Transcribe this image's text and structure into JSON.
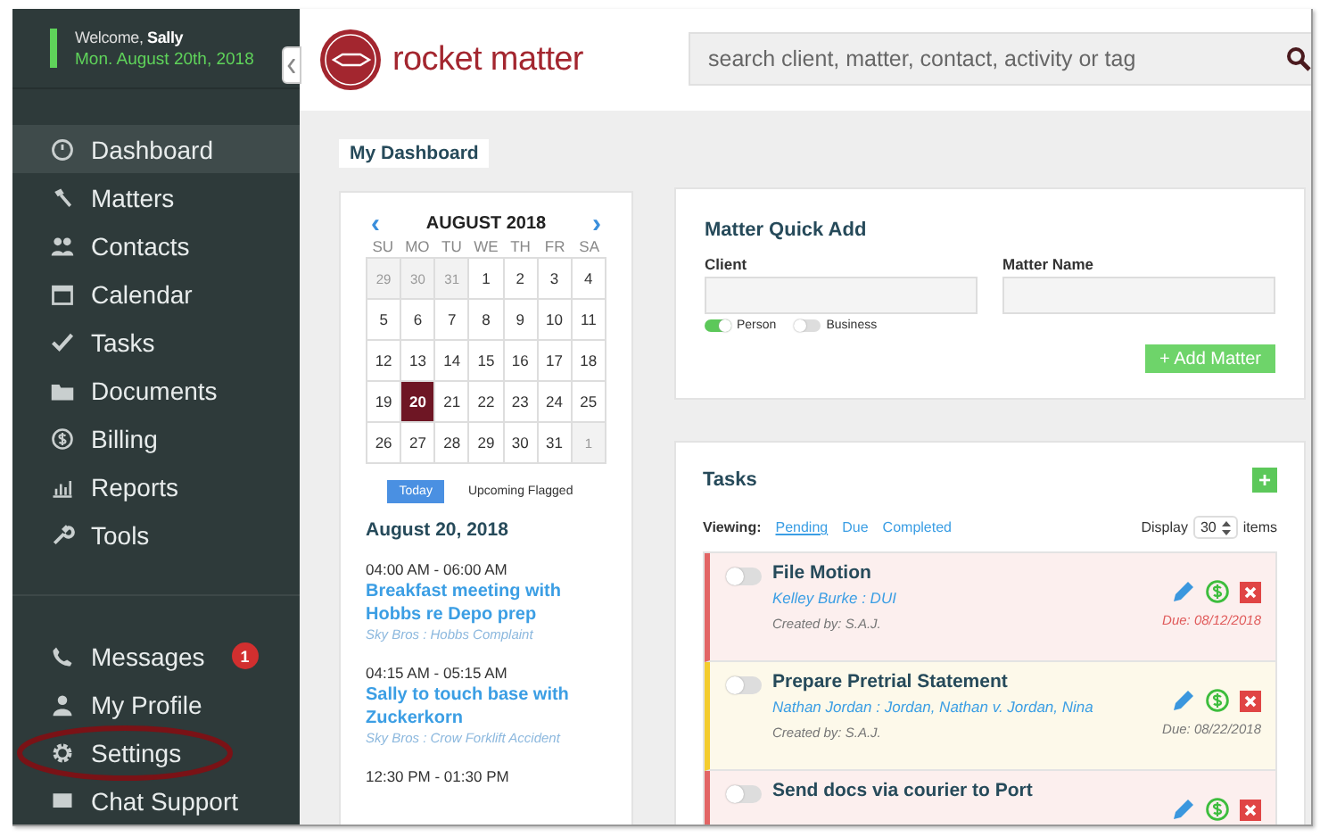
{
  "sidebar": {
    "welcome_label": "Welcome,",
    "user_name": "Sally",
    "date": "Mon. August 20th, 2018",
    "nav": [
      {
        "kind": "gauge",
        "label": "Dashboard",
        "selected": true
      },
      {
        "kind": "gavel",
        "label": "Matters",
        "selected": false
      },
      {
        "kind": "people",
        "label": "Contacts",
        "selected": false
      },
      {
        "kind": "calendar",
        "label": "Calendar",
        "selected": false
      },
      {
        "kind": "check",
        "label": "Tasks",
        "selected": false
      },
      {
        "kind": "folder",
        "label": "Documents",
        "selected": false
      },
      {
        "kind": "dollar",
        "label": "Billing",
        "selected": false
      },
      {
        "kind": "chart",
        "label": "Reports",
        "selected": false
      },
      {
        "kind": "wrench",
        "label": "Tools",
        "selected": false
      }
    ],
    "bottom": [
      {
        "kind": "phone",
        "label": "Messages",
        "badge": "1",
        "highlighted": false
      },
      {
        "kind": "person",
        "label": "My Profile",
        "highlighted": false
      },
      {
        "kind": "gear",
        "label": "Settings",
        "highlighted": true
      },
      {
        "kind": "chat",
        "label": "Chat Support",
        "highlighted": false
      }
    ]
  },
  "header": {
    "logo_text": "rocket matter",
    "search": {
      "placeholder": "search client, matter, contact, activity or tag"
    }
  },
  "page_tab": "My Dashboard",
  "calendar": {
    "prev": "‹",
    "month": "AUGUST 2018",
    "next": "›",
    "weekdays": [
      "SU",
      "MO",
      "TU",
      "WE",
      "TH",
      "FR",
      "SA"
    ],
    "days": [
      {
        "d": "29",
        "other": true,
        "selected": false
      },
      {
        "d": "30",
        "other": true,
        "selected": false
      },
      {
        "d": "31",
        "other": true,
        "selected": false
      },
      {
        "d": "1",
        "other": false,
        "selected": false
      },
      {
        "d": "2",
        "other": false,
        "selected": false
      },
      {
        "d": "3",
        "other": false,
        "selected": false
      },
      {
        "d": "4",
        "other": false,
        "selected": false
      },
      {
        "d": "5",
        "other": false,
        "selected": false
      },
      {
        "d": "6",
        "other": false,
        "selected": false
      },
      {
        "d": "7",
        "other": false,
        "selected": false
      },
      {
        "d": "8",
        "other": false,
        "selected": false
      },
      {
        "d": "9",
        "other": false,
        "selected": false
      },
      {
        "d": "10",
        "other": false,
        "selected": false
      },
      {
        "d": "11",
        "other": false,
        "selected": false
      },
      {
        "d": "12",
        "other": false,
        "selected": false
      },
      {
        "d": "13",
        "other": false,
        "selected": false
      },
      {
        "d": "14",
        "other": false,
        "selected": false
      },
      {
        "d": "15",
        "other": false,
        "selected": false
      },
      {
        "d": "16",
        "other": false,
        "selected": false
      },
      {
        "d": "17",
        "other": false,
        "selected": false
      },
      {
        "d": "18",
        "other": false,
        "selected": false
      },
      {
        "d": "19",
        "other": false,
        "selected": false
      },
      {
        "d": "20",
        "other": false,
        "selected": true
      },
      {
        "d": "21",
        "other": false,
        "selected": false
      },
      {
        "d": "22",
        "other": false,
        "selected": false
      },
      {
        "d": "23",
        "other": false,
        "selected": false
      },
      {
        "d": "24",
        "other": false,
        "selected": false
      },
      {
        "d": "25",
        "other": false,
        "selected": false
      },
      {
        "d": "26",
        "other": false,
        "selected": false
      },
      {
        "d": "27",
        "other": false,
        "selected": false
      },
      {
        "d": "28",
        "other": false,
        "selected": false
      },
      {
        "d": "29",
        "other": false,
        "selected": false
      },
      {
        "d": "30",
        "other": false,
        "selected": false
      },
      {
        "d": "31",
        "other": false,
        "selected": false
      },
      {
        "d": "1",
        "other": true,
        "selected": false
      }
    ],
    "views": [
      {
        "label": "Today",
        "selected": true
      },
      {
        "label": "Upcoming Flagged",
        "selected": false
      }
    ],
    "agenda_date": "August 20, 2018",
    "events": [
      {
        "time": "04:00 AM - 06:00 AM",
        "title": "Breakfast meeting with Hobbs re Depo prep",
        "matter": "Sky Bros : Hobbs Complaint"
      },
      {
        "time": "04:15 AM - 05:15 AM",
        "title": "Sally to touch base with Zuckerkorn",
        "matter": "Sky Bros : Crow Forklift Accident"
      },
      {
        "time": "12:30 PM - 01:30 PM"
      }
    ]
  },
  "quick_add": {
    "title": "Matter Quick Add",
    "fields": [
      {
        "label": "Client"
      },
      {
        "label": "Matter Name"
      }
    ],
    "client_types": [
      {
        "label": "Person",
        "on": true
      },
      {
        "label": "Business",
        "on": false
      }
    ],
    "button": "+ Add Matter"
  },
  "tasks": {
    "title": "Tasks",
    "add": "+",
    "viewing_label": "Viewing:",
    "filters": [
      {
        "label": "Pending",
        "selected": true
      },
      {
        "label": "Due",
        "selected": false
      },
      {
        "label": "Completed",
        "selected": false
      }
    ],
    "display_label": "Display",
    "display_value": "30",
    "items_label": "items",
    "list": [
      {
        "kind": "overdue",
        "done": false,
        "title": "File Motion",
        "matter": "Kelley Burke : DUI",
        "creator": "Created by: S.A.J.",
        "due": "Due: 08/12/2018"
      },
      {
        "kind": "upcoming",
        "done": false,
        "title": "Prepare Pretrial Statement",
        "matter": "Nathan Jordan : Jordan, Nathan v. Jordan, Nina",
        "creator": "Created by: S.A.J.",
        "due": "Due: 08/22/2018"
      },
      {
        "kind": "overdue",
        "done": false,
        "title": "Send docs via courier to Port"
      }
    ]
  }
}
